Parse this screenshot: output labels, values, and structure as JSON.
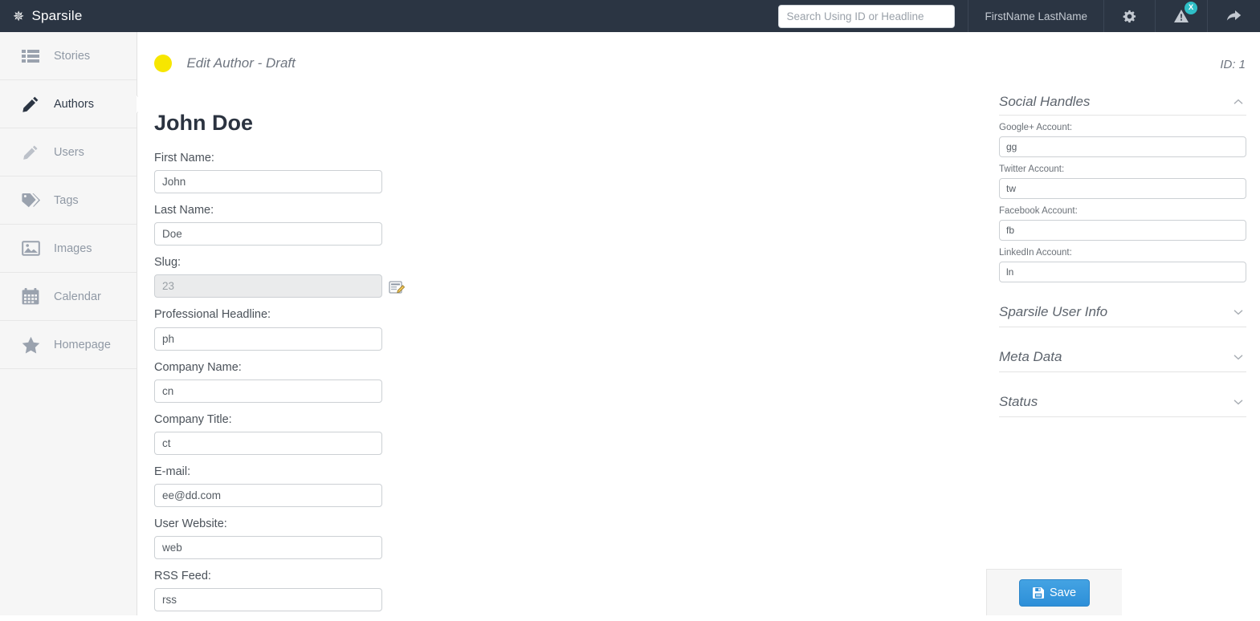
{
  "topbar": {
    "brand": "Sparsile",
    "brand_icon": "asterisk-star-icon",
    "search": {
      "placeholder": "Search Using ID or Headline",
      "value": ""
    },
    "user_name": "FirstName LastName",
    "settings_icon": "gear-icon",
    "alerts_icon": "warning-triangle-icon",
    "alerts_badge": "X",
    "share_icon": "forward-arrow-icon",
    "bg_color": "#2b3543",
    "badge_color": "#2fbfc7"
  },
  "sidebar": {
    "items": [
      {
        "label": "Stories",
        "icon": "list-icon",
        "active": false
      },
      {
        "label": "Authors",
        "icon": "pencil-icon",
        "active": true
      },
      {
        "label": "Users",
        "icon": "pencil-icon",
        "active": false
      },
      {
        "label": "Tags",
        "icon": "tag-icon",
        "active": false
      },
      {
        "label": "Images",
        "icon": "image-icon",
        "active": false
      },
      {
        "label": "Calendar",
        "icon": "calendar-icon",
        "active": false
      },
      {
        "label": "Homepage",
        "icon": "star-icon",
        "active": false
      }
    ]
  },
  "page": {
    "status_dot_color": "#f7e600",
    "subtitle": "Edit Author - Draft",
    "id_label": "ID: 1",
    "title": "John Doe"
  },
  "form": {
    "fields": [
      {
        "label": "First Name:",
        "value": "John",
        "name": "first-name",
        "disabled": false
      },
      {
        "label": "Last Name:",
        "value": "Doe",
        "name": "last-name",
        "disabled": false
      },
      {
        "label": "Slug:",
        "value": "23",
        "name": "slug",
        "disabled": true
      },
      {
        "label": "Professional Headline:",
        "value": "ph",
        "name": "professional-headline",
        "disabled": false
      },
      {
        "label": "Company Name:",
        "value": "cn",
        "name": "company-name",
        "disabled": false
      },
      {
        "label": "Company Title:",
        "value": "ct",
        "name": "company-title",
        "disabled": false
      },
      {
        "label": "E-mail:",
        "value": "ee@dd.com",
        "name": "email",
        "disabled": false
      },
      {
        "label": "User Website:",
        "value": "web",
        "name": "user-website",
        "disabled": false
      },
      {
        "label": "RSS Feed:",
        "value": "rss",
        "name": "rss-feed",
        "disabled": false
      }
    ],
    "slug_edit_icon": "edit-form-icon"
  },
  "right_panel": {
    "social": {
      "title": "Social Handles",
      "expanded": true,
      "chevron": "chevron-up-icon",
      "fields": [
        {
          "label": "Google+ Account:",
          "value": "gg",
          "name": "google-plus-account"
        },
        {
          "label": "Twitter Account:",
          "value": "tw",
          "name": "twitter-account"
        },
        {
          "label": "Facebook Account:",
          "value": "fb",
          "name": "facebook-account"
        },
        {
          "label": "LinkedIn Account:",
          "value": "ln",
          "name": "linkedin-account"
        }
      ]
    },
    "collapsed_sections": [
      {
        "title": "Sparsile User Info",
        "chevron": "chevron-down-icon",
        "name": "sparsile-user-info"
      },
      {
        "title": "Meta Data",
        "chevron": "chevron-down-icon",
        "name": "meta-data"
      },
      {
        "title": "Status",
        "chevron": "chevron-down-icon",
        "name": "status"
      }
    ]
  },
  "footer": {
    "save_label": "Save",
    "save_icon": "floppy-disk-icon",
    "save_color": "#2d8fd8"
  }
}
